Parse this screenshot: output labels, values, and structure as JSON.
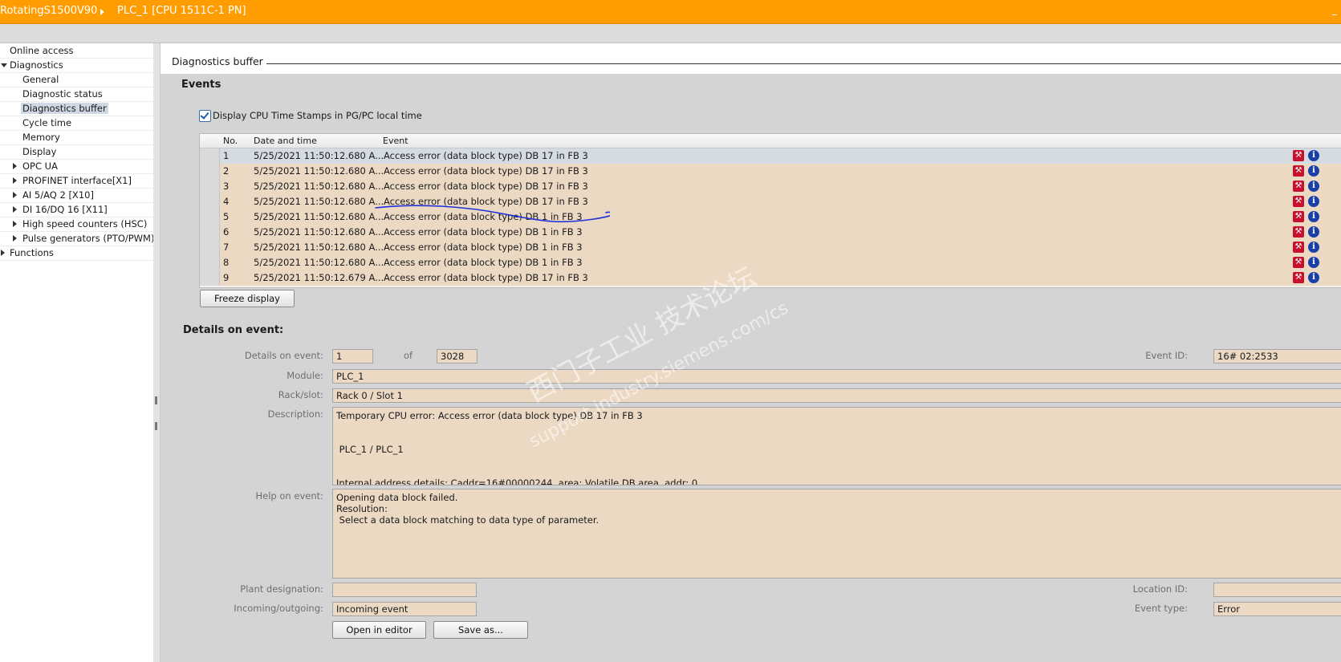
{
  "titlebar": {
    "project": "RotatingS1500V90",
    "device": "PLC_1 [CPU 1511C-1 PN]",
    "min_icon": "_"
  },
  "sidebar": {
    "items": [
      {
        "label": "Online access"
      },
      {
        "label": "Diagnostics"
      },
      {
        "label": "General"
      },
      {
        "label": "Diagnostic status"
      },
      {
        "label": "Diagnostics buffer"
      },
      {
        "label": "Cycle time"
      },
      {
        "label": "Memory"
      },
      {
        "label": "Display"
      },
      {
        "label": "OPC UA"
      },
      {
        "label": "PROFINET interface[X1]"
      },
      {
        "label": "AI 5/AQ 2 [X10]"
      },
      {
        "label": "DI 16/DQ 16 [X11]"
      },
      {
        "label": "High speed counters (HSC)"
      },
      {
        "label": "Pulse generators (PTO/PWM)"
      },
      {
        "label": "Functions"
      }
    ]
  },
  "header": {
    "title": "Diagnostics buffer"
  },
  "events": {
    "section_title": "Events",
    "checkbox_label": "Display CPU Time Stamps in PG/PC local time",
    "checkbox_checked": true,
    "columns": [
      "No.",
      "Date and time",
      "Event"
    ],
    "rows": [
      {
        "no": "1",
        "datetime": "5/25/2021 11:50:12.680 A...",
        "event": "Access error (data block type) DB 17 in FB 3"
      },
      {
        "no": "2",
        "datetime": "5/25/2021 11:50:12.680 A...",
        "event": "Access error (data block type) DB 17 in FB 3"
      },
      {
        "no": "3",
        "datetime": "5/25/2021 11:50:12.680 A...",
        "event": "Access error (data block type) DB 17 in FB 3"
      },
      {
        "no": "4",
        "datetime": "5/25/2021 11:50:12.680 A...",
        "event": "Access error (data block type) DB 17 in FB 3"
      },
      {
        "no": "5",
        "datetime": "5/25/2021 11:50:12.680 A...",
        "event": "Access error (data block type) DB 1 in FB 3"
      },
      {
        "no": "6",
        "datetime": "5/25/2021 11:50:12.680 A...",
        "event": "Access error (data block type) DB 1 in FB 3"
      },
      {
        "no": "7",
        "datetime": "5/25/2021 11:50:12.680 A...",
        "event": "Access error (data block type) DB 1 in FB 3"
      },
      {
        "no": "8",
        "datetime": "5/25/2021 11:50:12.680 A...",
        "event": "Access error (data block type) DB 1 in FB 3"
      },
      {
        "no": "9",
        "datetime": "5/25/2021 11:50:12.679 A...",
        "event": "Access error (data block type) DB 17 in FB 3"
      }
    ],
    "freeze_button": "Freeze display",
    "wrench_icon": "wrench-icon",
    "info_icon": "info-icon",
    "info_glyph": "i"
  },
  "details": {
    "section_title": "Details on event:",
    "details_label": "Details on event:",
    "details_value": "1",
    "of_label": "of",
    "of_value": "3028",
    "event_id_label": "Event ID:",
    "event_id_value": "16# 02:2533",
    "module_label": "Module:",
    "module_value": "PLC_1",
    "rackslot_label": "Rack/slot:",
    "rackslot_value": "Rack 0 / Slot 1",
    "description_label": "Description:",
    "description_value": "Temporary CPU error: Access error (data block type) DB 17 in FB 3\n\n\n PLC_1 / PLC_1\n\n\nInternal address details: Caddr=16#00000244, area: Volatile DB area, addr: 0",
    "help_label": "Help on event:",
    "help_value": "Opening data block failed.\nResolution:\n Select a data block matching to data type of parameter.",
    "plant_label": "Plant designation:",
    "plant_value": "",
    "location_label": "Location ID:",
    "location_value": "",
    "incoming_label": "Incoming/outgoing:",
    "incoming_value": "Incoming event",
    "event_type_label": "Event type:",
    "event_type_value": "Error",
    "open_editor_button": "Open in editor",
    "save_as_button": "Save as..."
  },
  "watermark": {
    "line1": "西门子工业 技术论坛",
    "line2": "support.industry.siemens.com/cs"
  },
  "colors": {
    "title_bar": "#ff9d00",
    "row_bg": "#ebd9c4",
    "selected_row": "#d5dbe2",
    "error_icon": "#c8102e",
    "info_icon": "#1a3fa8"
  }
}
